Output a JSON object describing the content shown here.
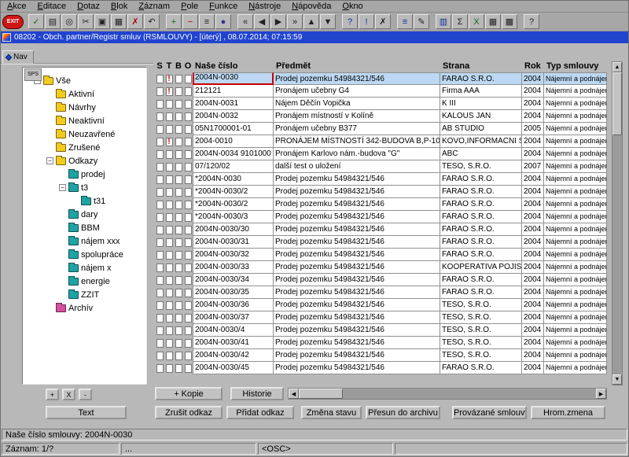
{
  "menu": [
    "Akce",
    "Editace",
    "Dotaz",
    "Blok",
    "Záznam",
    "Pole",
    "Funkce",
    "Nástroje",
    "Nápověda",
    "Okno"
  ],
  "toolbar": [
    {
      "name": "exit-button",
      "label": "EXIT"
    },
    {
      "name": "commit-icon",
      "glyph": "✓",
      "color": "#0a6a0a"
    },
    {
      "name": "print-icon",
      "glyph": "▤",
      "color": "#222222"
    },
    {
      "name": "search-icon",
      "glyph": "◎",
      "color": "#222222"
    },
    {
      "name": "cut-icon",
      "glyph": "✂",
      "color": "#222222"
    },
    {
      "name": "copy-icon",
      "glyph": "▣",
      "color": "#222222"
    },
    {
      "name": "paste-icon",
      "glyph": "▦",
      "color": "#222222"
    },
    {
      "name": "delete-icon",
      "glyph": "✗",
      "color": "#aa0000"
    },
    {
      "name": "undo-icon",
      "glyph": "↶",
      "color": "#222222"
    },
    {
      "name": "insert-record-icon",
      "glyph": "+",
      "color": "#0a6a0a",
      "gap": true
    },
    {
      "name": "remove-record-icon",
      "glyph": "−",
      "color": "#aa0000"
    },
    {
      "name": "duplicate-record-icon",
      "glyph": "≡",
      "color": "#222222"
    },
    {
      "name": "lock-record-icon",
      "glyph": "●",
      "color": "#333388"
    },
    {
      "name": "first-record-icon",
      "glyph": "«",
      "color": "#222222",
      "gap": true
    },
    {
      "name": "prev-record-icon",
      "glyph": "◀",
      "color": "#222222"
    },
    {
      "name": "next-record-icon",
      "glyph": "▶",
      "color": "#222222"
    },
    {
      "name": "last-record-icon",
      "glyph": "»",
      "color": "#222222"
    },
    {
      "name": "prev-block-icon",
      "glyph": "▲",
      "color": "#222222"
    },
    {
      "name": "next-block-icon",
      "glyph": "▼",
      "color": "#222222"
    },
    {
      "name": "enter-query-icon",
      "glyph": "?",
      "color": "#10309a",
      "gap": true
    },
    {
      "name": "execute-query-icon",
      "glyph": "!",
      "color": "#10309a"
    },
    {
      "name": "cancel-query-icon",
      "glyph": "✗",
      "color": "#222222"
    },
    {
      "name": "list-values-icon",
      "glyph": "≡",
      "color": "#10309a",
      "gap": true
    },
    {
      "name": "edit-icon",
      "glyph": "✎",
      "color": "#222222"
    },
    {
      "name": "catalog-icon",
      "glyph": "▥",
      "color": "#10309a",
      "gap": true
    },
    {
      "name": "sum-icon",
      "glyph": "Σ",
      "color": "#222222"
    },
    {
      "name": "excel-icon",
      "glyph": "X",
      "color": "#0a6a0a"
    },
    {
      "name": "calendar-icon",
      "glyph": "▦",
      "color": "#222222"
    },
    {
      "name": "calculator-icon",
      "glyph": "▩",
      "color": "#222222"
    },
    {
      "name": "help-icon",
      "glyph": "?",
      "color": "#222222",
      "gap": true
    }
  ],
  "title": "08202 - Obch. partner/Registr smluv (RSMLOUVY) - [úterý] , 08.07.2014; 07:15:59",
  "nav": {
    "tab_label": "Nav",
    "sps_label": "SPS"
  },
  "tree": [
    {
      "label": "Vše",
      "level": 0,
      "color": "yellow",
      "expanded": true
    },
    {
      "label": "Aktivní",
      "level": 1,
      "color": "yellow"
    },
    {
      "label": "Návrhy",
      "level": 1,
      "color": "yellow"
    },
    {
      "label": "Neaktivní",
      "level": 1,
      "color": "yellow"
    },
    {
      "label": "Neuzavřené",
      "level": 1,
      "color": "yellow"
    },
    {
      "label": "Zrušené",
      "level": 1,
      "color": "yellow"
    },
    {
      "label": "Odkazy",
      "level": 1,
      "color": "yellow",
      "expanded": true
    },
    {
      "label": "prodej",
      "level": 2,
      "color": "teal"
    },
    {
      "label": "t3",
      "level": 2,
      "color": "teal",
      "expanded": true
    },
    {
      "label": "t31",
      "level": 3,
      "color": "teal"
    },
    {
      "label": "dary",
      "level": 2,
      "color": "teal"
    },
    {
      "label": "BBM",
      "level": 2,
      "color": "teal"
    },
    {
      "label": "nájem xxx",
      "level": 2,
      "color": "teal"
    },
    {
      "label": "spolupráce",
      "level": 2,
      "color": "teal"
    },
    {
      "label": "nájem x",
      "level": 2,
      "color": "teal"
    },
    {
      "label": "energie",
      "level": 2,
      "color": "teal"
    },
    {
      "label": "ZZIT",
      "level": 2,
      "color": "teal"
    },
    {
      "label": "Archív",
      "level": 1,
      "color": "magenta"
    }
  ],
  "table": {
    "flag_columns": [
      "S",
      "T",
      "B",
      "O"
    ],
    "columns": [
      "Naše číslo",
      "Předmět",
      "Strana",
      "Rok",
      "Typ smlouvy"
    ],
    "rows": [
      {
        "flags": [
          "",
          "!",
          "",
          ""
        ],
        "cislo": "2004N-0030",
        "predmet": "Prodej pozemku 54984321/546",
        "strana": "FARAO S.R.O.",
        "rok": "2004",
        "typ": "Nájemní a podnájemn",
        "selected": true
      },
      {
        "flags": [
          "",
          "!",
          "",
          ""
        ],
        "cislo": "212121",
        "predmet": "Pronájem učebny G4",
        "strana": "Firma AAA",
        "rok": "2004",
        "typ": "Nájemní a podnájemn"
      },
      {
        "flags": [
          "",
          "",
          "",
          ""
        ],
        "cislo": "2004N-0031",
        "predmet": "Nájem Děčín Vopička",
        "strana": "K III",
        "rok": "2004",
        "typ": "Nájemní a podnájemn"
      },
      {
        "flags": [
          "",
          "",
          "",
          ""
        ],
        "cislo": "2004N-0032",
        "predmet": "Pronájem místností v Kolíně",
        "strana": "KALOUS JAN",
        "rok": "2004",
        "typ": "Nájemní a podnájemn"
      },
      {
        "flags": [
          "",
          "",
          "",
          ""
        ],
        "cislo": "05N1700001-01",
        "predmet": "Pronájem učebny B377",
        "strana": "AB STUDIO",
        "rok": "2005",
        "typ": "Nájemní a podnájemn"
      },
      {
        "flags": [
          "",
          "!",
          "",
          ""
        ],
        "cislo": "2004-0010",
        "predmet": "PRONÁJEM MÍSTNOSTÍ 342-BUDOVA B,P-10",
        "strana": "KOVO,INFORMACNI SYS",
        "rok": "2004",
        "typ": "Nájemní a podnájemn"
      },
      {
        "flags": [
          "",
          "",
          "",
          ""
        ],
        "cislo": "2004N-0034 9101000",
        "predmet": "Pronájem Karlovo nám.-budova \"G\"",
        "strana": "ABC",
        "rok": "2004",
        "typ": "Nájemní a podnájemn"
      },
      {
        "flags": [
          "",
          "",
          "",
          ""
        ],
        "cislo": "07/120/02",
        "predmet": "další test o uložení",
        "strana": "TESO, S.R.O.",
        "rok": "2007",
        "typ": "Nájemní a podnájemn"
      },
      {
        "flags": [
          "",
          "",
          "",
          ""
        ],
        "cislo": "*2004N-0030",
        "predmet": "Prodej pozemku 54984321/546",
        "strana": "FARAO S.R.O.",
        "rok": "2004",
        "typ": "Nájemní a podnájemn"
      },
      {
        "flags": [
          "",
          "",
          "",
          ""
        ],
        "cislo": "*2004N-0030/2",
        "predmet": "Prodej pozemku 54984321/546",
        "strana": "FARAO S.R.O.",
        "rok": "2004",
        "typ": "Nájemní a podnájemn"
      },
      {
        "flags": [
          "",
          "",
          "",
          ""
        ],
        "cislo": "*2004N-0030/2",
        "predmet": "Prodej pozemku 54984321/546",
        "strana": "FARAO S.R.O.",
        "rok": "2004",
        "typ": "Nájemní a podnájemn"
      },
      {
        "flags": [
          "",
          "",
          "",
          ""
        ],
        "cislo": "*2004N-0030/3",
        "predmet": "Prodej pozemku 54984321/546",
        "strana": "FARAO S.R.O.",
        "rok": "2004",
        "typ": "Nájemní a podnájemn"
      },
      {
        "flags": [
          "",
          "",
          "",
          ""
        ],
        "cislo": "2004N-0030/30",
        "predmet": "Prodej pozemku 54984321/546",
        "strana": "FARAO S.R.O.",
        "rok": "2004",
        "typ": "Nájemní a podnájemn"
      },
      {
        "flags": [
          "",
          "",
          "",
          ""
        ],
        "cislo": "2004N-0030/31",
        "predmet": "Prodej pozemku 54984321/546",
        "strana": "FARAO S.R.O.",
        "rok": "2004",
        "typ": "Nájemní a podnájemn"
      },
      {
        "flags": [
          "",
          "",
          "",
          ""
        ],
        "cislo": "2004N-0030/32",
        "predmet": "Prodej pozemku 54984321/546",
        "strana": "FARAO S.R.O.",
        "rok": "2004",
        "typ": "Nájemní a podnájemn"
      },
      {
        "flags": [
          "",
          "",
          "",
          ""
        ],
        "cislo": "2004N-0030/33",
        "predmet": "Prodej pozemku 54984321/546",
        "strana": "KOOPERATIVA POJISTO",
        "rok": "2004",
        "typ": "Nájemní a podnájemn"
      },
      {
        "flags": [
          "",
          "",
          "",
          ""
        ],
        "cislo": "2004N-0030/34",
        "predmet": "Prodej pozemku 54984321/546",
        "strana": "FARAO S.R.O.",
        "rok": "2004",
        "typ": "Nájemní a podnájemn"
      },
      {
        "flags": [
          "",
          "",
          "",
          ""
        ],
        "cislo": "2004N-0030/35",
        "predmet": "Prodej pozemku 54984321/546",
        "strana": "FARAO S.R.O.",
        "rok": "2004",
        "typ": "Nájemní a podnájemn"
      },
      {
        "flags": [
          "",
          "",
          "",
          ""
        ],
        "cislo": "2004N-0030/36",
        "predmet": "Prodej pozemku 54984321/546",
        "strana": "TESO, S.R.O.",
        "rok": "2004",
        "typ": "Nájemní a podnájemn"
      },
      {
        "flags": [
          "",
          "",
          "",
          ""
        ],
        "cislo": "2004N-0030/37",
        "predmet": "Prodej pozemku 54984321/546",
        "strana": "TESO, S.R.O.",
        "rok": "2004",
        "typ": "Nájemní a podnájemn"
      },
      {
        "flags": [
          "",
          "",
          "",
          ""
        ],
        "cislo": "2004N-0030/4",
        "predmet": "Prodej pozemku 54984321/546",
        "strana": "TESO, S.R.O.",
        "rok": "2004",
        "typ": "Nájemní a podnájemn"
      },
      {
        "flags": [
          "",
          "",
          "",
          ""
        ],
        "cislo": "2004N-0030/41",
        "predmet": "Prodej pozemku 54984321/546",
        "strana": "TESO, S.R.O.",
        "rok": "2004",
        "typ": "Nájemní a podnájemn"
      },
      {
        "flags": [
          "",
          "",
          "",
          ""
        ],
        "cislo": "2004N-0030/42",
        "predmet": "Prodej pozemku 54984321/546",
        "strana": "TESO, S.R.O.",
        "rok": "2004",
        "typ": "Nájemní a podnájemn"
      },
      {
        "flags": [
          "",
          "",
          "",
          ""
        ],
        "cislo": "2004N-0030/45",
        "predmet": "Prodej pozemku 54984321/546",
        "strana": "FARAO S.R.O.",
        "rok": "2004",
        "typ": "Nájemní a podnájemn"
      }
    ]
  },
  "tree_buttons": [
    "+",
    "X",
    "-"
  ],
  "text_button": "Text",
  "action_buttons_row1": [
    "+ Kopie",
    "Historie"
  ],
  "action_buttons_row2": [
    "Zrušit odkaz",
    "Přidat odkaz",
    "Změna stavu",
    "Přesun do archivu",
    "Provázané smlouvy",
    "Hrom.zmena"
  ],
  "scrollbar": {
    "up": "▲",
    "down": "▼",
    "left": "◀",
    "right": "▶"
  },
  "status": {
    "line1": "Naše číslo smlouvy: 2004N-0030",
    "record": "Záznam: 1/?",
    "dots": "...",
    "osc": "<OSC>"
  },
  "colors": {
    "title_blue": "#2144cf",
    "sel_row": "#bcd8f2",
    "folder_yellow": "#f2cb1e",
    "folder_teal": "#1fa3a3",
    "folder_magenta": "#d44f9e",
    "flag_red": "#cc0000",
    "exit_red": "#cf1616"
  }
}
